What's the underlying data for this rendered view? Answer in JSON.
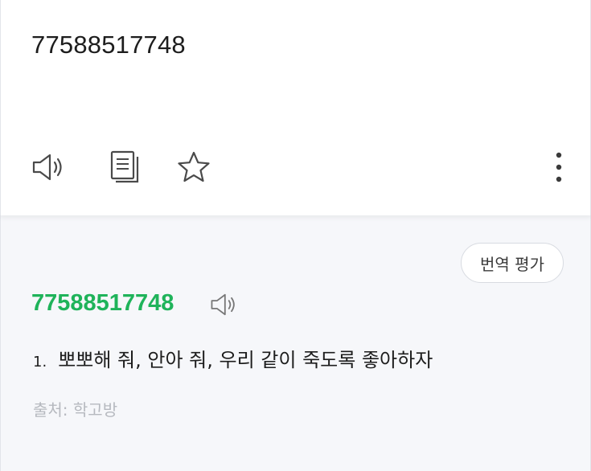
{
  "source": {
    "text": "77588517748"
  },
  "toolbar": {
    "icons": [
      "speaker-icon",
      "copy-icon",
      "star-icon",
      "more-vertical-icon"
    ]
  },
  "result": {
    "rate_button_label": "번역 평가",
    "word": "77588517748",
    "word_color": "#1fb35a",
    "meanings": [
      {
        "number": "1.",
        "text": "뽀뽀해 줘, 안아 줘, 우리 같이 죽도록 좋아하자"
      }
    ],
    "source_note": "출처: 학고방"
  }
}
